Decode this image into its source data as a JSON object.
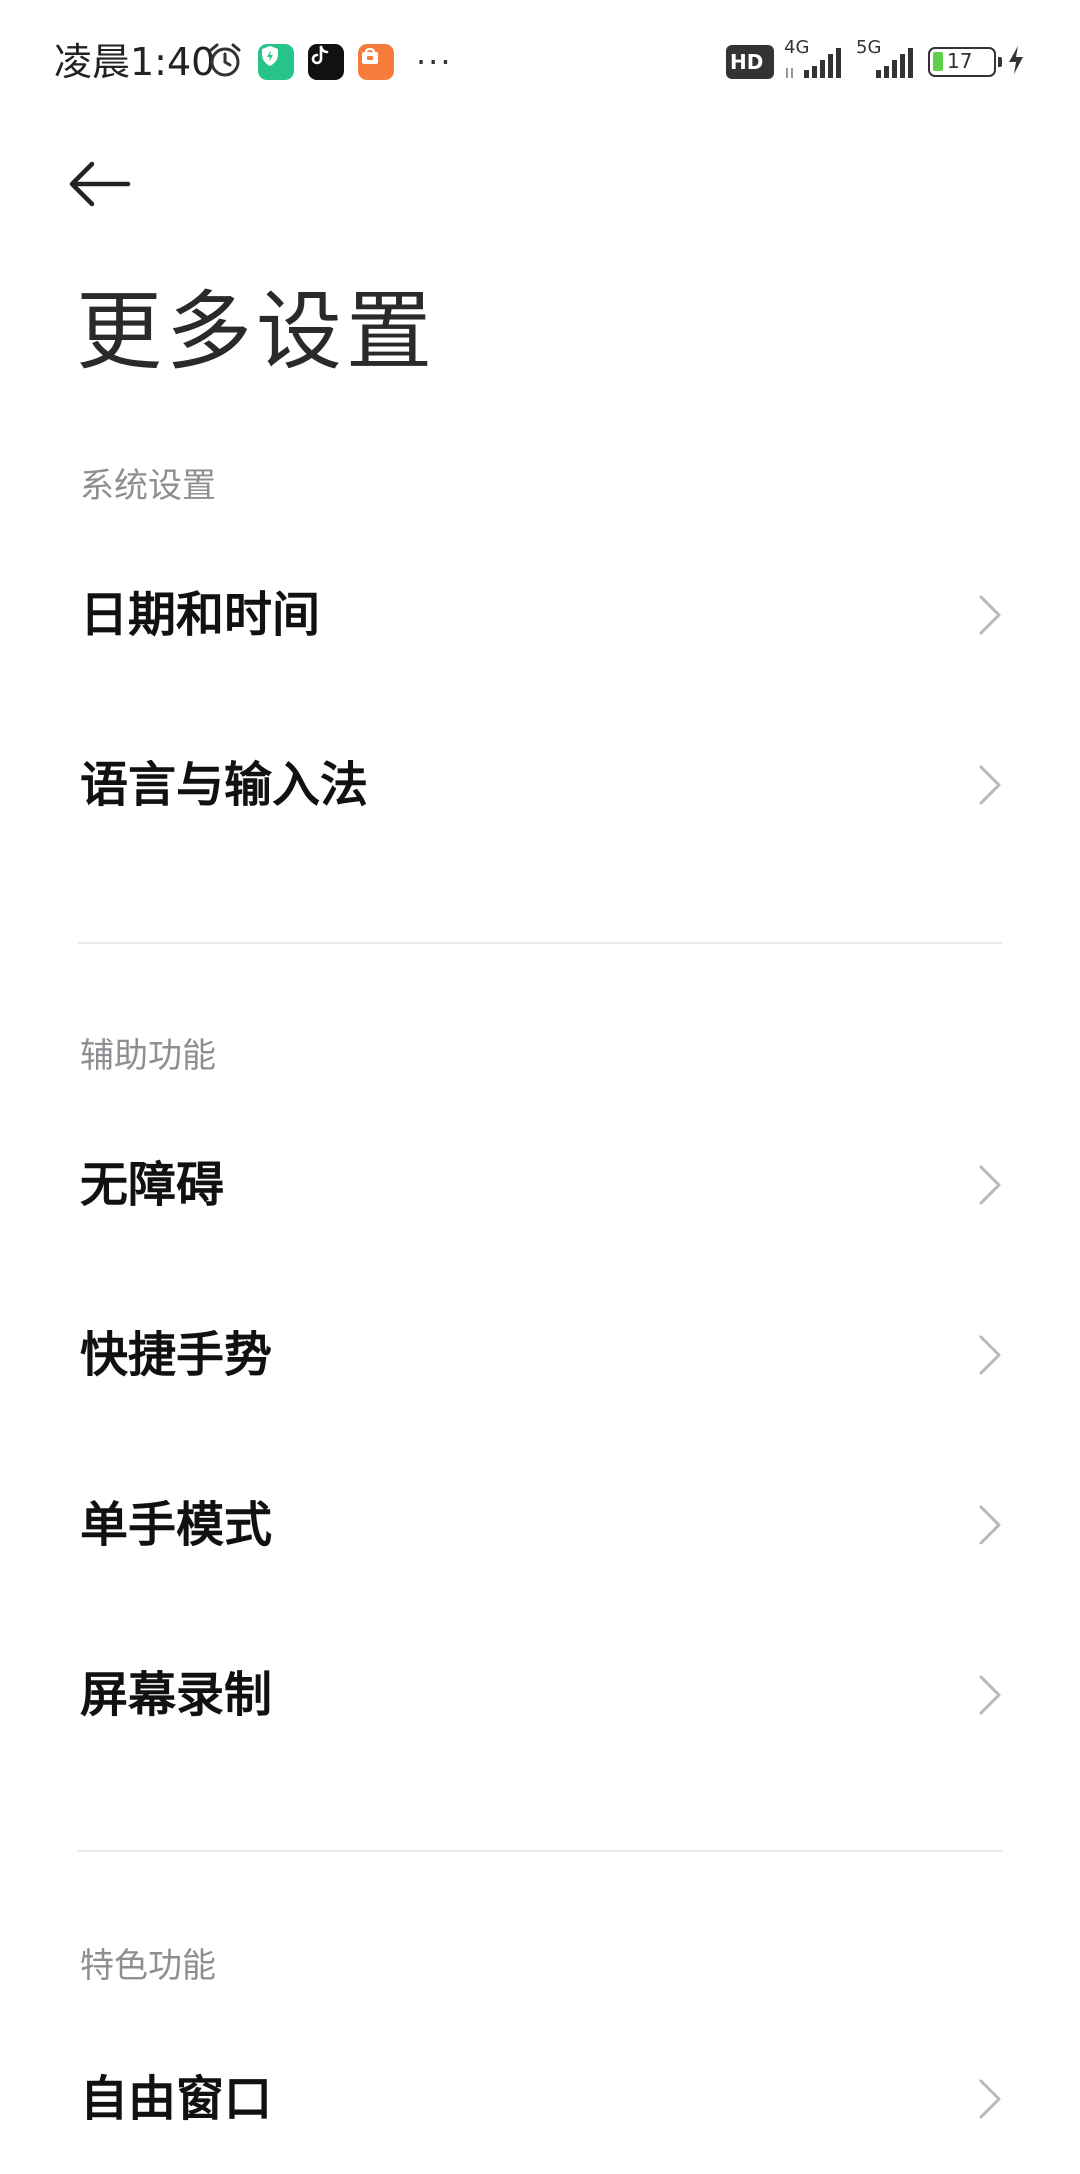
{
  "status_bar": {
    "time": "凌晨1:40",
    "more": "···",
    "hd_label": "HD",
    "net_4g": "4G",
    "net_5g": "5G",
    "battery": "17",
    "icons": [
      "alarm-icon",
      "security-app-icon",
      "tiktok-app-icon",
      "mi-store-app-icon",
      "more-dots-icon",
      "hd-voice-icon",
      "signal-4g-icon",
      "signal-5g-icon",
      "battery-icon",
      "charging-icon"
    ]
  },
  "header": {
    "back_icon": "back-arrow-icon",
    "title": "更多设置"
  },
  "sections": [
    {
      "header": "系统设置",
      "items": [
        {
          "label": "日期和时间"
        },
        {
          "label": "语言与输入法"
        }
      ]
    },
    {
      "header": "辅助功能",
      "items": [
        {
          "label": "无障碍"
        },
        {
          "label": "快捷手势"
        },
        {
          "label": "单手模式"
        },
        {
          "label": "屏幕录制"
        }
      ]
    },
    {
      "header": "特色功能",
      "items": [
        {
          "label": "自由窗口"
        }
      ]
    }
  ],
  "colors": {
    "background": "#ffffff",
    "title": "#2a2a2a",
    "section_header": "#8e8e93",
    "item_text": "#111111",
    "chevron": "#b8b8b8",
    "divider": "#e8e8e8",
    "battery_fill": "#5fcf4a",
    "security_app": "#27c48a",
    "mi_store_app": "#f57c3a"
  }
}
